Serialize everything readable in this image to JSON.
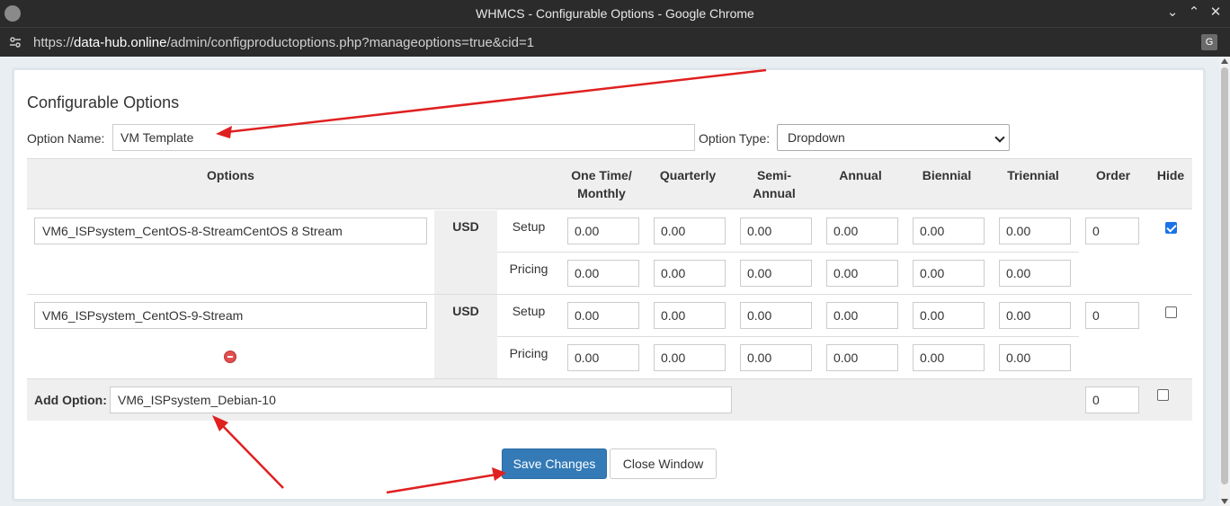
{
  "window": {
    "title": "WHMCS - Configurable Options - Google Chrome"
  },
  "address_bar": {
    "prefix": "https://",
    "host": "data-hub.online",
    "path": "/admin/configproductoptions.php?manageoptions=true&cid=1"
  },
  "page": {
    "title": "Configurable Options",
    "option_name_label": "Option Name:",
    "option_name_value": "VM Template",
    "option_type_label": "Option Type:",
    "option_type_value": "Dropdown"
  },
  "table": {
    "headers": {
      "options": "Options",
      "one_time_1": "One Time/",
      "one_time_2": "Monthly",
      "quarterly": "Quarterly",
      "semi_1": "Semi-",
      "semi_2": "Annual",
      "annual": "Annual",
      "biennial": "Biennial",
      "triennial": "Triennial",
      "order": "Order",
      "hide": "Hide"
    },
    "rows": [
      {
        "name": "VM6_ISPsystem_CentOS-8-StreamCentOS 8 Stream",
        "currency": "USD",
        "setup_label": "Setup",
        "pricing_label": "Pricing",
        "setup": [
          "0.00",
          "0.00",
          "0.00",
          "0.00",
          "0.00",
          "0.00"
        ],
        "pricing": [
          "0.00",
          "0.00",
          "0.00",
          "0.00",
          "0.00",
          "0.00"
        ],
        "order": "0",
        "hidden": true
      },
      {
        "name": "VM6_ISPsystem_CentOS-9-Stream",
        "currency": "USD",
        "setup_label": "Setup",
        "pricing_label": "Pricing",
        "setup": [
          "0.00",
          "0.00",
          "0.00",
          "0.00",
          "0.00",
          "0.00"
        ],
        "pricing": [
          "0.00",
          "0.00",
          "0.00",
          "0.00",
          "0.00",
          "0.00"
        ],
        "order": "0",
        "hidden": false
      }
    ],
    "add_option_label": "Add Option:",
    "add_option_value": "VM6_ISPsystem_Debian-10",
    "add_order": "0"
  },
  "buttons": {
    "save": "Save Changes",
    "close": "Close Window"
  },
  "colors": {
    "annotation_arrow": "#e02020",
    "primary": "#337ab7"
  }
}
